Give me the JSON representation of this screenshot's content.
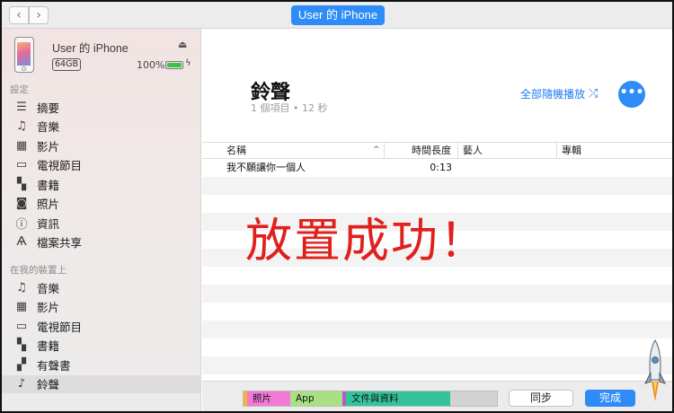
{
  "window": {
    "device_pill": "User 的 iPhone",
    "back_glyph": "‹",
    "forward_glyph": "›"
  },
  "device": {
    "name": "User 的 iPhone",
    "capacity": "64GB",
    "battery": "100%",
    "battery_level": 1.0
  },
  "sidebar": {
    "settings_label": "設定",
    "settings_items": [
      {
        "label": "摘要",
        "icon": "summary-list-icon",
        "glyph": "☰"
      },
      {
        "label": "音樂",
        "icon": "music-note-icon",
        "glyph": "♫"
      },
      {
        "label": "影片",
        "icon": "film-icon",
        "glyph": "▦"
      },
      {
        "label": "電視節目",
        "icon": "tv-icon",
        "glyph": "▭"
      },
      {
        "label": "書籍",
        "icon": "book-icon",
        "glyph": "▚"
      },
      {
        "label": "照片",
        "icon": "camera-icon",
        "glyph": "◙"
      },
      {
        "label": "資訊",
        "icon": "info-icon",
        "glyph": "ⓘ"
      },
      {
        "label": "檔案共享",
        "icon": "app-store-icon",
        "glyph": "Ѧ"
      }
    ],
    "ondevice_label": "在我的裝置上",
    "ondevice_items": [
      {
        "label": "音樂",
        "icon": "music-note-icon",
        "glyph": "♫"
      },
      {
        "label": "影片",
        "icon": "film-icon",
        "glyph": "▦"
      },
      {
        "label": "電視節目",
        "icon": "tv-icon",
        "glyph": "▭"
      },
      {
        "label": "書籍",
        "icon": "book-icon",
        "glyph": "▚"
      },
      {
        "label": "有聲書",
        "icon": "audiobook-icon",
        "glyph": "▞"
      },
      {
        "label": "鈴聲",
        "icon": "bell-icon",
        "glyph": "♪"
      }
    ]
  },
  "main": {
    "title": "鈴聲",
    "subtitle": "1 個項目 • 12 秒",
    "shuffle_label": "全部隨機播放",
    "shuffle_glyph": "⤮",
    "more_glyph": "•••",
    "overlay": "放置成功！"
  },
  "table": {
    "columns": [
      "名稱",
      "時間長度",
      "藝人",
      "專輯"
    ],
    "sort_glyph": "^",
    "rows": [
      {
        "name": "我不願讓你一個人",
        "duration": "0:13",
        "artist": "",
        "album": ""
      }
    ]
  },
  "storage": {
    "segments": [
      {
        "label": "照片",
        "color": "#f27ad6"
      },
      {
        "label": "App",
        "color": "#a9e084"
      },
      {
        "label": "文件與資料",
        "color": "#35c49a"
      }
    ]
  },
  "footer": {
    "sync_label": "同步",
    "done_label": "完成"
  },
  "colors": {
    "accent": "#2f8cf7",
    "overlay_red": "#e0201c"
  }
}
